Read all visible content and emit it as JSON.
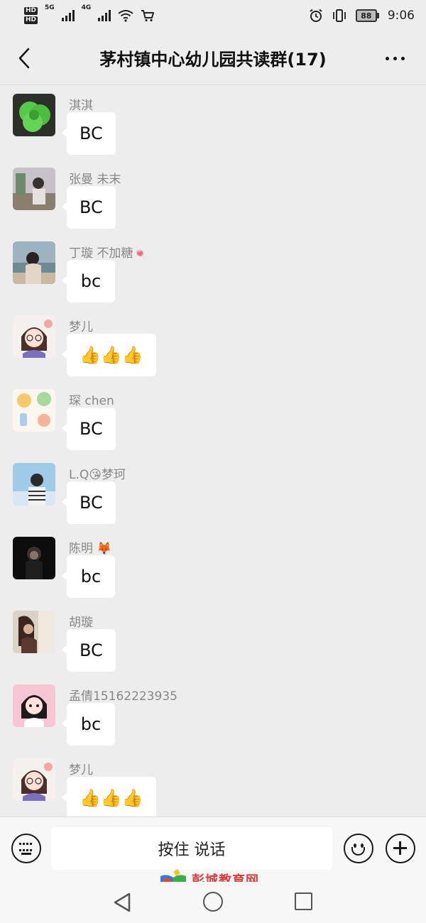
{
  "status_bar": {
    "hd1": "HD",
    "hd2": "HD",
    "net1": "5G",
    "net2": "4G",
    "battery": "88",
    "time": "9:06"
  },
  "header": {
    "title": "茅村镇中心幼儿园共读群(17)"
  },
  "messages": [
    {
      "sender": "淇淇",
      "text": "BC"
    },
    {
      "sender": "张曼  未末",
      "text": "BC"
    },
    {
      "sender": "丁璇   不加糖🍬",
      "text": "bc"
    },
    {
      "sender": "梦儿",
      "text": "👍👍👍"
    },
    {
      "sender": "琛  chen",
      "text": "BC"
    },
    {
      "sender": "L.Q😘梦珂",
      "text": "BC"
    },
    {
      "sender": "陈明  🦊",
      "text": "bc"
    },
    {
      "sender": "胡璇",
      "text": "BC"
    },
    {
      "sender": "孟倩15162223935",
      "text": "bc"
    },
    {
      "sender": "梦儿",
      "text": "👍👍👍"
    }
  ],
  "input_bar": {
    "hold_to_talk": "按住 说话"
  },
  "watermark": {
    "text": "彭城教育网"
  },
  "icons": {
    "back": "back-arrow-icon",
    "more": "more-dots-icon",
    "keyboard": "keyboard-icon",
    "emoji": "emoji-icon",
    "plus": "plus-icon"
  },
  "colors": {
    "background": "#ededed",
    "bubble": "#ffffff",
    "sender_name": "#888888",
    "watermark": "#e03b3b"
  }
}
